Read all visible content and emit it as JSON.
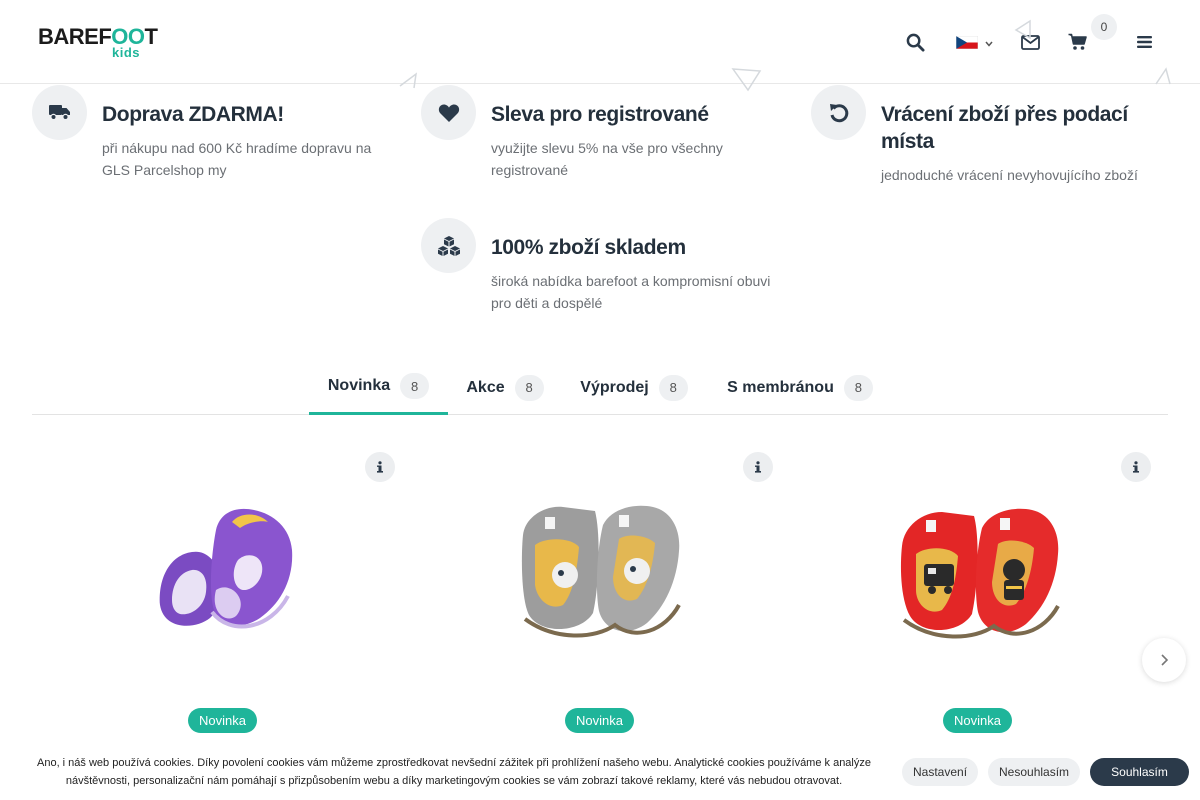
{
  "header": {
    "logo_text_left": "BAREF",
    "logo_text_oo": "OO",
    "logo_text_right": "T",
    "logo_kids": "kids",
    "search_icon": "search-icon",
    "language_icon": "czech-flag-icon",
    "mail_icon": "envelope-icon",
    "cart_icon": "shopping-cart-icon",
    "cart_count": "0",
    "menu_icon": "hamburger-menu-icon"
  },
  "features": [
    {
      "icon": "truck-icon",
      "title": "Doprava ZDARMA!",
      "text_line1": "při nákupu nad 600 Kč hradíme dopravu na",
      "text_line2": "GLS Parcelshop my"
    },
    {
      "icon": "heart-icon",
      "title": "Sleva pro registrované",
      "text_line1": "využijte slevu 5% na vše pro všechny",
      "text_line2": "registrované"
    },
    {
      "icon": "undo-icon",
      "title_line1": "Vrácení zboží přes podací",
      "title_line2": "místa",
      "text_line1": "jednoduché vrácení nevyhovujícího zboží"
    },
    {
      "icon": "cubes-icon",
      "title": "100% zboží skladem",
      "text_line1": "široká nabídka barefoot a kompromisní obuvi",
      "text_line2": "pro děti a dospělé"
    }
  ],
  "tabs": [
    {
      "label": "Novinka",
      "count": "8",
      "active": true
    },
    {
      "label": "Akce",
      "count": "8"
    },
    {
      "label": "Výprodej",
      "count": "8"
    },
    {
      "label": "S membránou",
      "count": "8"
    }
  ],
  "products": [
    {
      "image": "purple-unicorn-slipper",
      "badge": "Novinka",
      "color": "#7b4bc2"
    },
    {
      "image": "grey-koala-astronaut-slipper",
      "badge": "Novinka",
      "color": "#9a9a9a"
    },
    {
      "image": "red-firefighter-slipper",
      "badge": "Novinka",
      "color": "#e02a2a"
    }
  ],
  "cookie_bar": {
    "text_line1": "Ano, i náš web používá cookies. Díky povolení cookies vám můžeme zprostředkovat nevšední zážitek při prohlížení našeho webu. Analytické cookies používáme k analýze",
    "text_line2": "návštěvnosti, personalizační nám pomáhají s přizpůsobením webu a díky marketingovým cookies se vám zobrazí takové reklamy, které vás nebudou otravovat.",
    "settings_label": "Nastavení",
    "disagree_label": "Nesouhlasím",
    "agree_label": "Souhlasím"
  },
  "colors": {
    "accent": "#1fb59a",
    "dark": "#2b3a4a",
    "light_bg": "#eef0f2"
  }
}
